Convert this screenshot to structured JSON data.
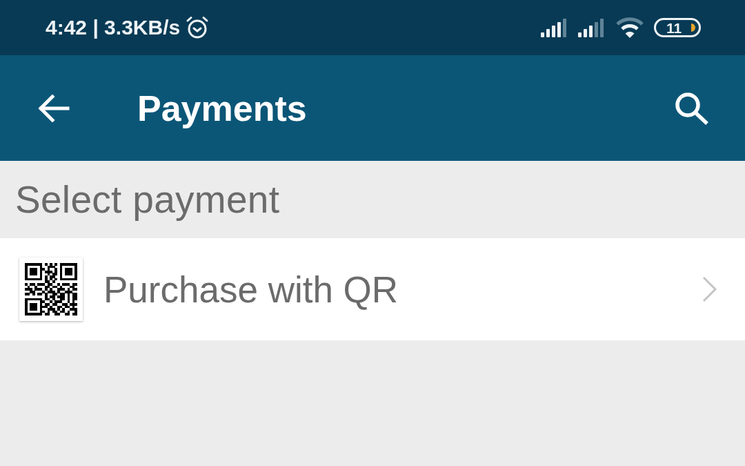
{
  "status_bar": {
    "time_and_speed": "4:42 | 3.3KB/s",
    "battery": "11"
  },
  "app_bar": {
    "title": "Payments"
  },
  "section": {
    "title": "Select payment"
  },
  "options": [
    {
      "label": "Purchase with QR"
    }
  ]
}
